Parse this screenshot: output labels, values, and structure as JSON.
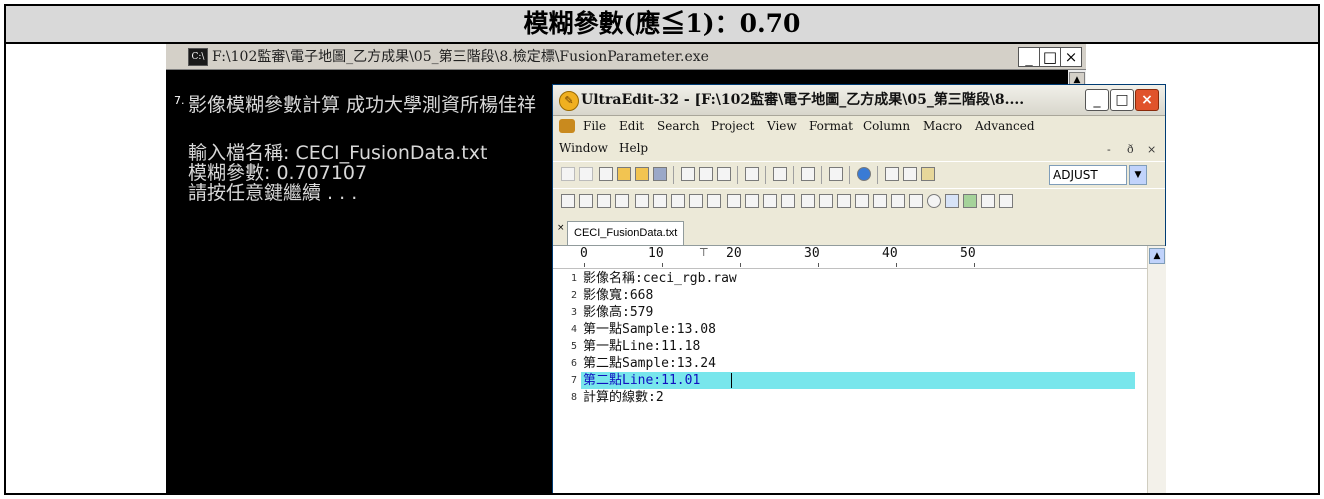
{
  "doc_header": {
    "text": "模糊參數(應≦1)：0.70"
  },
  "console": {
    "title": "F:\\102監審\\電子地圖_乙方成果\\05_第三階段\\8.檢定標\\FusionParameter.exe",
    "icon_label": "C:\\",
    "line_marker": "7.",
    "lines": [
      "影像模糊參數計算 成功大學測資所楊佳祥",
      "",
      "輸入檔名稱: CECI_FusionData.txt",
      "模糊參數: 0.707107",
      "請按任意鍵繼續 . . ."
    ],
    "buttons": {
      "minimize": "_",
      "maximize": "□",
      "close": "×"
    }
  },
  "ultraedit": {
    "title": "UltraEdit-32 - [F:\\102監審\\電子地圖_乙方成果\\05_第三階段\\8....",
    "buttons": {
      "minimize": "_",
      "maximize": "□",
      "close": "×"
    },
    "menu": [
      "File",
      "Edit",
      "Search",
      "Project",
      "View",
      "Format",
      "Column",
      "Macro",
      "Advanced",
      "Window",
      "Help"
    ],
    "mdi_controls": [
      "-",
      "ð",
      "×"
    ],
    "combo_value": "ADJUST",
    "tab_label": "CECI_FusionData.txt",
    "ruler": [
      "0",
      "10",
      "20",
      "30",
      "40",
      "50"
    ],
    "lines": [
      {
        "num": "1",
        "text": "影像名稱:ceci_rgb.raw"
      },
      {
        "num": "2",
        "text": "影像寬:668"
      },
      {
        "num": "3",
        "text": "影像高:579"
      },
      {
        "num": "4",
        "text": "第一點Sample:13.08"
      },
      {
        "num": "5",
        "text": "第一點Line:11.18"
      },
      {
        "num": "6",
        "text": "第二點Sample:13.24"
      },
      {
        "num": "7",
        "text": "第二點Line:11.01"
      },
      {
        "num": "8",
        "text": "計算的線數:2"
      }
    ],
    "selected_line": 7
  }
}
